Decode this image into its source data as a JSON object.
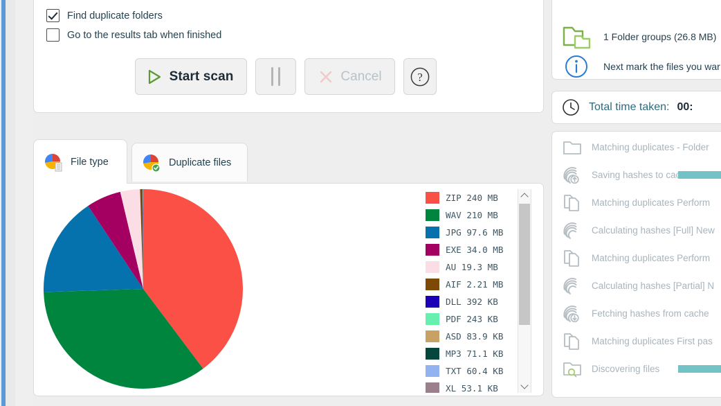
{
  "options": {
    "checkboxes": [
      {
        "label": "Find duplicate folders",
        "checked": true,
        "name": "find-duplicate-folders"
      },
      {
        "label": "Go to the results tab when finished",
        "checked": false,
        "name": "go-to-results-tab"
      }
    ],
    "buttons": {
      "start": "Start scan",
      "pause": "",
      "cancel": "Cancel",
      "help": "?"
    }
  },
  "tabs": [
    {
      "label": "File type",
      "active": true
    },
    {
      "label": "Duplicate files",
      "active": false
    }
  ],
  "chart_data": {
    "type": "pie",
    "title": "File type",
    "legend_position": "right",
    "unit_note": "sizes shown in legend labels",
    "categories": [
      "ZIP",
      "WAV",
      "JPG",
      "EXE",
      "AU",
      "AIF",
      "DLL",
      "PDF",
      "ASD",
      "MP3",
      "TXT",
      "XL"
    ],
    "labels": [
      "ZIP 240 MB",
      "WAV 210 MB",
      "JPG 97.6 MB",
      "EXE 34.0 MB",
      "AU 19.3 MB",
      "AIF 2.21 MB",
      "DLL 392 KB",
      "PDF 243 KB",
      "ASD 83.9 KB",
      "MP3 71.1 KB",
      "TXT 60.4 KB",
      "XL 53.1 KB"
    ],
    "values_mb": [
      240,
      210,
      97.6,
      34.0,
      19.3,
      2.21,
      0.3828,
      0.2373,
      0.0819,
      0.0694,
      0.059,
      0.0519
    ],
    "colors": [
      "#fb5046",
      "#00853f",
      "#0672ad",
      "#a30061",
      "#fbdde5",
      "#7c4a06",
      "#1b00b5",
      "#66f0b0",
      "#c8a164",
      "#04463c",
      "#92b3ef",
      "#9b7f8c"
    ]
  },
  "results": {
    "folder_groups": "1 Folder groups (26.8 MB)",
    "next_step": "Next mark the files you war"
  },
  "time": {
    "label": "Total time taken:",
    "value": "00:"
  },
  "tasks": [
    {
      "label": "Matching duplicates - Folder",
      "icon": "folder-icon",
      "progress": 0
    },
    {
      "label": "Saving hashes to cache",
      "icon": "fingerprint-upload-icon",
      "progress": 100
    },
    {
      "label": "Matching duplicates Perform",
      "icon": "copy-icon",
      "progress": 0
    },
    {
      "label": "Calculating hashes [Full] New",
      "icon": "fingerprint-icon",
      "progress": 0
    },
    {
      "label": "Matching duplicates Perform",
      "icon": "copy-icon",
      "progress": 0
    },
    {
      "label": "Calculating hashes [Partial] N",
      "icon": "fingerprint-icon",
      "progress": 0
    },
    {
      "label": "Fetching hashes from cache",
      "icon": "fingerprint-download-icon",
      "progress": 0
    },
    {
      "label": "Matching duplicates First pas",
      "icon": "copy-icon",
      "progress": 0
    },
    {
      "label": "Discovering files",
      "icon": "folder-search-icon",
      "progress": 100
    }
  ],
  "colors": {
    "accent_blue": "#5b9bd5",
    "teal_progress": "#73c3c6",
    "folder_green": "#7cb04a",
    "info_blue": "#2b7cd3",
    "text_dark": "#24414f",
    "text_muted": "#a9b4bb"
  }
}
